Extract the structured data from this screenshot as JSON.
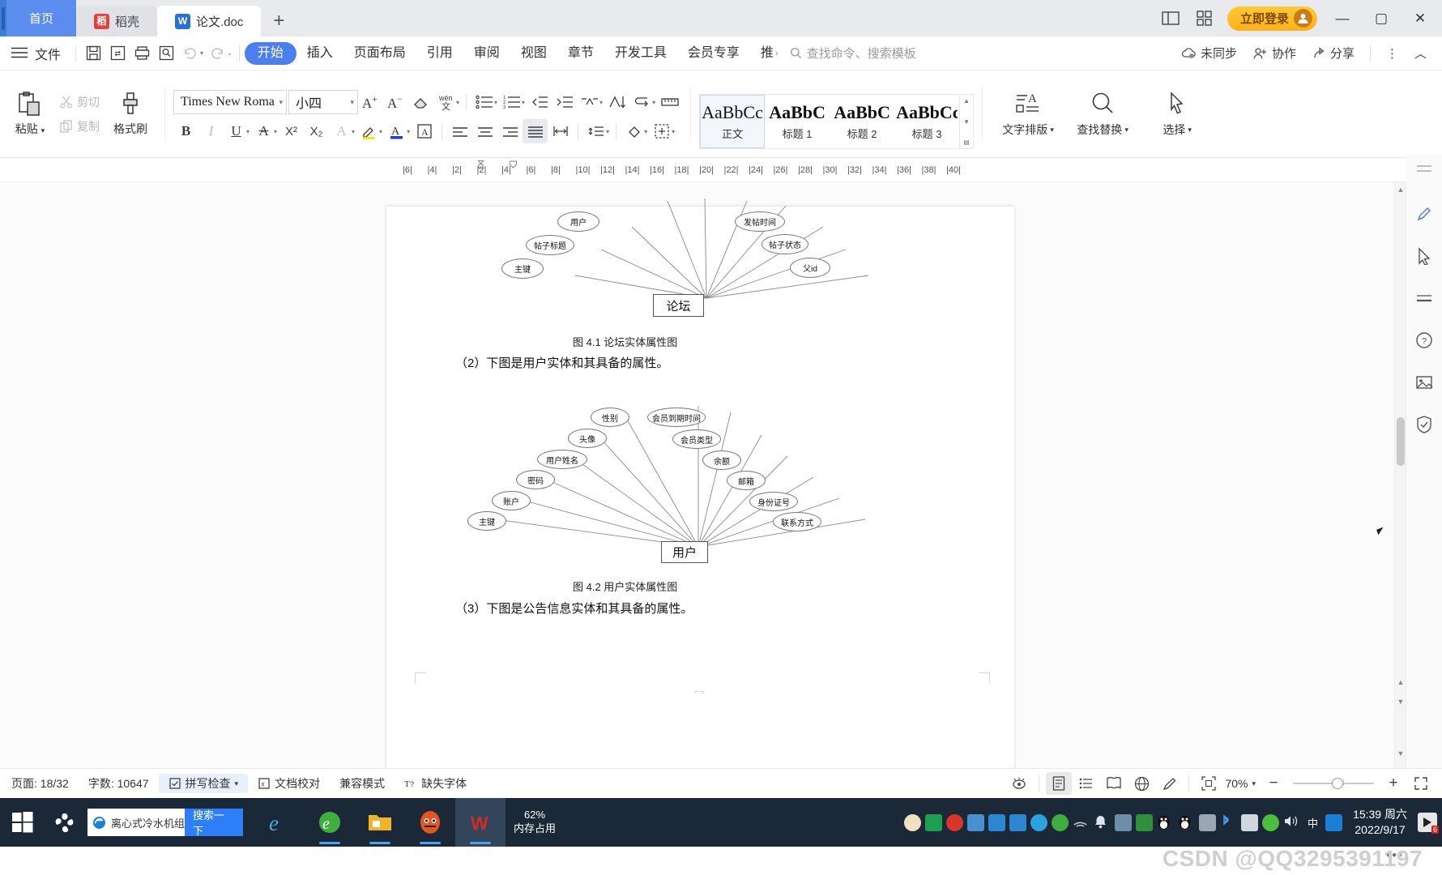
{
  "window": {
    "tabs": [
      {
        "label": "首页",
        "icon": "home-tab",
        "state": "home"
      },
      {
        "label": "稻壳",
        "icon": "docer-icon",
        "state": "inactive"
      },
      {
        "label": "论文.doc",
        "icon": "wps-writer-icon",
        "state": "active"
      }
    ],
    "new_tab_label": "+",
    "login_label": "立即登录",
    "minimize": "—",
    "maximize": "▢",
    "close": "✕"
  },
  "menu": {
    "file_label": "文件",
    "quick_icons": [
      "save-icon",
      "save-as-icon",
      "print-icon",
      "print-preview-icon",
      "undo-icon",
      "redo-icon",
      "customize-icon"
    ],
    "tabs": [
      {
        "label": "开始",
        "active": true
      },
      {
        "label": "插入",
        "active": false
      },
      {
        "label": "页面布局",
        "active": false
      },
      {
        "label": "引用",
        "active": false
      },
      {
        "label": "审阅",
        "active": false
      },
      {
        "label": "视图",
        "active": false
      },
      {
        "label": "章节",
        "active": false
      },
      {
        "label": "开发工具",
        "active": false
      },
      {
        "label": "会员专享",
        "active": false
      },
      {
        "label": "推",
        "active": false
      }
    ],
    "search_placeholder": "查找命令、搜索模板",
    "right_items": [
      {
        "label": "未同步",
        "icon": "cloud-sync-icon"
      },
      {
        "label": "协作",
        "icon": "collaborate-icon"
      },
      {
        "label": "分享",
        "icon": "share-icon"
      }
    ],
    "more_label": "⋮",
    "collapse_label": "︿"
  },
  "ribbon": {
    "paste_label": "粘贴",
    "cut_label": "剪切",
    "copy_label": "复制",
    "format_painter_label": "格式刷",
    "font_name": "Times New Roma",
    "font_size": "小四",
    "styles": [
      {
        "preview": "AaBbCcI",
        "label": "正文",
        "bold": false,
        "selected": true
      },
      {
        "preview": "AaBbC",
        "label": "标题 1",
        "bold": true,
        "selected": false
      },
      {
        "preview": "AaBbC",
        "label": "标题 2",
        "bold": true,
        "selected": false
      },
      {
        "preview": "AaBbCcI",
        "label": "标题 3",
        "bold": true,
        "selected": false
      }
    ],
    "text_layout_label": "文字排版",
    "find_replace_label": "查找替换",
    "select_label": "选择"
  },
  "ruler": {
    "ticks": [
      "6",
      "4",
      "2",
      "2",
      "4",
      "6",
      "8",
      "10",
      "12",
      "14",
      "16",
      "18",
      "20",
      "22",
      "24",
      "26",
      "28",
      "30",
      "32",
      "34",
      "36",
      "38",
      "40"
    ]
  },
  "document": {
    "fig1": {
      "entity": "论坛",
      "attributes": [
        "主键",
        "帖子标题",
        "用户",
        "发帖时间",
        "帖子状态",
        "父id"
      ],
      "caption": "图 4.1 论坛实体属性图"
    },
    "para1": "（2）下图是用户实体和其具备的属性。",
    "fig2": {
      "entity": "用户",
      "attributes": [
        "主键",
        "账户",
        "密码",
        "用户姓名",
        "头像",
        "性别",
        "会员到期时间",
        "会员类型",
        "余额",
        "邮箱",
        "身份证号",
        "联系方式"
      ],
      "caption": "图 4.2 用户实体属性图"
    },
    "para2": "（3）下图是公告信息实体和其具备的属性。"
  },
  "status": {
    "page_label": "页面: 18/32",
    "words_label": "字数: 10647",
    "spellcheck_label": "拼写检查",
    "proofread_label": "文档校对",
    "compat_label": "兼容模式",
    "missing_font_label": "缺失字体",
    "zoom_label": "70%",
    "view_icons": [
      "eye-icon",
      "print-layout-icon",
      "outline-icon",
      "reading-icon",
      "web-layout-icon",
      "edit-pen-icon"
    ],
    "fit_icon": "fit-page-icon",
    "zoom_out": "−",
    "zoom_in": "+",
    "fullscreen_icon": "fullscreen-icon"
  },
  "taskbar": {
    "start_icon": "windows-start-icon",
    "search_query": "离心式冷水机组",
    "search_button": "搜索一下",
    "memory_percent": "62%",
    "memory_label": "内存占用",
    "time": "15:39 周六",
    "date": "2022/9/17",
    "tray_badge": "6",
    "ime_label": "中"
  },
  "watermark": "CSDN @QQ3295391197",
  "colors": {
    "accent_blue": "#4b7ff0",
    "tab_home_blue": "#5b8def",
    "login_gold": "#ffb019",
    "taskbar_dark": "#1b2838",
    "doc_bg": "#fbfbfb"
  }
}
